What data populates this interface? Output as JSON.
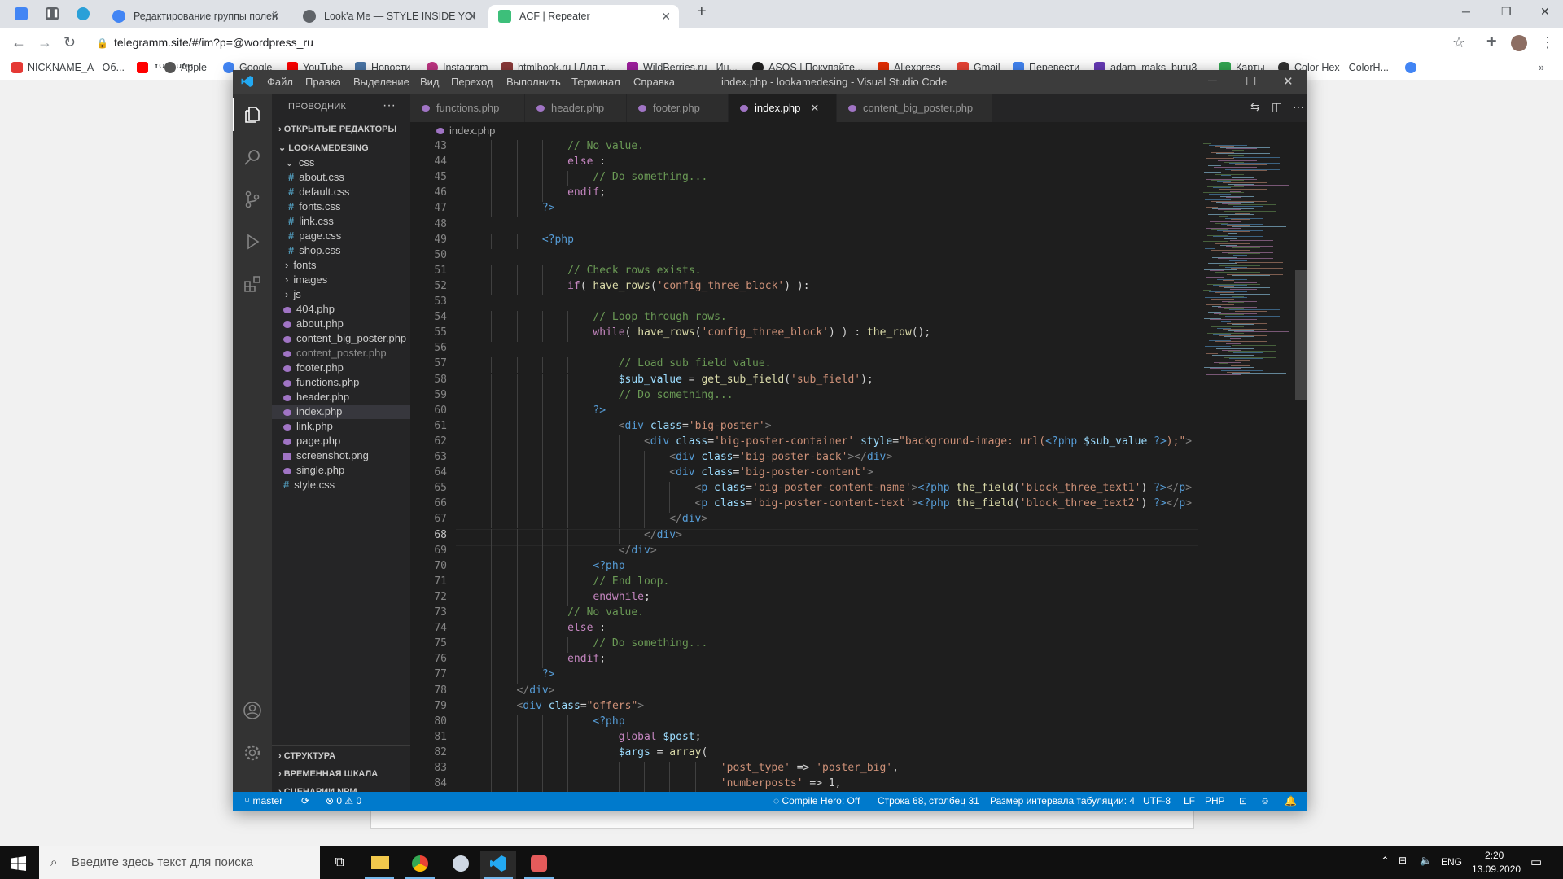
{
  "browser": {
    "tabs": [
      {
        "title": "Редактирование группы полей",
        "color": "#4285f4"
      },
      {
        "title": "Look'a Me — STYLE INSIDE YOU",
        "color": "#5f6368"
      },
      {
        "title": "ACF | Repeater",
        "color": "#3dbf7a"
      }
    ],
    "url": "telegramm.site/#/im?p=@wordpress_ru",
    "bookmarks": [
      "NICKNAME_A - Об...",
      "YouTube",
      "Apple",
      "Google",
      "Новости",
      "Instagram",
      "htmlbook.ru | Для т...",
      "WildBerries.ru - Ин...",
      "ASOS | Покупайте...",
      "Aliexpress",
      "Gmail",
      "Перевести",
      "adam_maks_butu3",
      "Карты",
      "Color Hex - ColorH..."
    ]
  },
  "vscode": {
    "menu": [
      "Файл",
      "Правка",
      "Выделение",
      "Вид",
      "Переход",
      "Выполнить",
      "Терминал",
      "Справка"
    ],
    "window_title": "index.php - lookamedesing - Visual Studio Code",
    "explorer": {
      "title": "ПРОВОДНИК",
      "open_editors": "ОТКРЫТЫЕ РЕДАКТОРЫ",
      "project": "LOOKAMEDESING",
      "tree": [
        {
          "label": "css",
          "type": "folder-open"
        },
        {
          "label": "about.css",
          "type": "css"
        },
        {
          "label": "default.css",
          "type": "css"
        },
        {
          "label": "fonts.css",
          "type": "css"
        },
        {
          "label": "link.css",
          "type": "css"
        },
        {
          "label": "page.css",
          "type": "css"
        },
        {
          "label": "shop.css",
          "type": "css"
        },
        {
          "label": "fonts",
          "type": "folder"
        },
        {
          "label": "images",
          "type": "folder"
        },
        {
          "label": "js",
          "type": "folder"
        },
        {
          "label": "404.php",
          "type": "php"
        },
        {
          "label": "about.php",
          "type": "php"
        },
        {
          "label": "content_big_poster.php",
          "type": "php"
        },
        {
          "label": "content_poster.php",
          "type": "php-dim"
        },
        {
          "label": "footer.php",
          "type": "php"
        },
        {
          "label": "functions.php",
          "type": "php"
        },
        {
          "label": "header.php",
          "type": "php"
        },
        {
          "label": "index.php",
          "type": "php-sel"
        },
        {
          "label": "link.php",
          "type": "php"
        },
        {
          "label": "page.php",
          "type": "php"
        },
        {
          "label": "screenshot.png",
          "type": "img"
        },
        {
          "label": "single.php",
          "type": "php"
        },
        {
          "label": "style.css",
          "type": "css-root"
        }
      ],
      "bottom_sections": [
        "СТРУКТУРА",
        "ВРЕМЕННАЯ ШКАЛА",
        "СЦЕНАРИИ NPM"
      ]
    },
    "tabs": [
      "functions.php",
      "header.php",
      "footer.php",
      "index.php",
      "content_big_poster.php"
    ],
    "active_tab": "index.php",
    "breadcrumb": "index.php",
    "cursor_line": 68,
    "code_lines": [
      {
        "n": 43,
        "i": 4,
        "t": [
          [
            "c-cm",
            "// No value."
          ]
        ]
      },
      {
        "n": 44,
        "i": 4,
        "t": [
          [
            "c-kw",
            "else"
          ],
          [
            "c-w",
            " :"
          ]
        ]
      },
      {
        "n": 45,
        "i": 5,
        "t": [
          [
            "c-cm",
            "// Do something..."
          ]
        ]
      },
      {
        "n": 46,
        "i": 4,
        "t": [
          [
            "c-kw",
            "endif"
          ],
          [
            "c-w",
            ";"
          ]
        ]
      },
      {
        "n": 47,
        "i": 3,
        "t": [
          [
            "c-tag",
            "?>"
          ]
        ]
      },
      {
        "n": 48,
        "i": 0,
        "t": []
      },
      {
        "n": 49,
        "i": 3,
        "t": [
          [
            "c-tag",
            "<?php"
          ]
        ]
      },
      {
        "n": 50,
        "i": 0,
        "t": []
      },
      {
        "n": 51,
        "i": 4,
        "t": [
          [
            "c-cm",
            "// Check rows exists."
          ]
        ]
      },
      {
        "n": 52,
        "i": 4,
        "t": [
          [
            "c-kw",
            "if"
          ],
          [
            "c-w",
            "( "
          ],
          [
            "c-fn",
            "have_rows"
          ],
          [
            "c-w",
            "("
          ],
          [
            "c-str",
            "'config_three_block'"
          ],
          [
            "c-w",
            ") ):"
          ]
        ]
      },
      {
        "n": 53,
        "i": 0,
        "t": []
      },
      {
        "n": 54,
        "i": 5,
        "t": [
          [
            "c-cm",
            "// Loop through rows."
          ]
        ]
      },
      {
        "n": 55,
        "i": 5,
        "t": [
          [
            "c-kw",
            "while"
          ],
          [
            "c-w",
            "( "
          ],
          [
            "c-fn",
            "have_rows"
          ],
          [
            "c-w",
            "("
          ],
          [
            "c-str",
            "'config_three_block'"
          ],
          [
            "c-w",
            ") ) : "
          ],
          [
            "c-fn",
            "the_row"
          ],
          [
            "c-w",
            "();"
          ]
        ]
      },
      {
        "n": 56,
        "i": 0,
        "t": []
      },
      {
        "n": 57,
        "i": 6,
        "t": [
          [
            "c-cm",
            "// Load sub field value."
          ]
        ]
      },
      {
        "n": 58,
        "i": 6,
        "t": [
          [
            "c-var",
            "$sub_value"
          ],
          [
            "c-w",
            " = "
          ],
          [
            "c-fn",
            "get_sub_field"
          ],
          [
            "c-w",
            "("
          ],
          [
            "c-str",
            "'sub_field'"
          ],
          [
            "c-w",
            ");"
          ]
        ]
      },
      {
        "n": 59,
        "i": 6,
        "t": [
          [
            "c-cm",
            "// Do something..."
          ]
        ]
      },
      {
        "n": 60,
        "i": 5,
        "t": [
          [
            "c-tag",
            "?>"
          ]
        ]
      },
      {
        "n": 61,
        "i": 6,
        "t": [
          [
            "c-pun",
            "<"
          ],
          [
            "c-tag",
            "div"
          ],
          [
            "c-w",
            " "
          ],
          [
            "c-at",
            "class"
          ],
          [
            "c-w",
            "="
          ],
          [
            "c-str",
            "'big-poster'"
          ],
          [
            "c-pun",
            ">"
          ]
        ]
      },
      {
        "n": 62,
        "i": 7,
        "t": [
          [
            "c-pun",
            "<"
          ],
          [
            "c-tag",
            "div"
          ],
          [
            "c-w",
            " "
          ],
          [
            "c-at",
            "class"
          ],
          [
            "c-w",
            "="
          ],
          [
            "c-str",
            "'big-poster-container'"
          ],
          [
            "c-w",
            " "
          ],
          [
            "c-at",
            "style"
          ],
          [
            "c-w",
            "="
          ],
          [
            "c-str",
            "\"background-image: url("
          ],
          [
            "c-tag",
            "<?php"
          ],
          [
            "c-w",
            " "
          ],
          [
            "c-var",
            "$sub_value"
          ],
          [
            "c-w",
            " "
          ],
          [
            "c-tag",
            "?>"
          ],
          [
            "c-str",
            ");\""
          ],
          [
            "c-pun",
            ">"
          ]
        ]
      },
      {
        "n": 63,
        "i": 8,
        "t": [
          [
            "c-pun",
            "<"
          ],
          [
            "c-tag",
            "div"
          ],
          [
            "c-w",
            " "
          ],
          [
            "c-at",
            "class"
          ],
          [
            "c-w",
            "="
          ],
          [
            "c-str",
            "'big-poster-back'"
          ],
          [
            "c-pun",
            "></"
          ],
          [
            "c-tag",
            "div"
          ],
          [
            "c-pun",
            ">"
          ]
        ]
      },
      {
        "n": 64,
        "i": 8,
        "t": [
          [
            "c-pun",
            "<"
          ],
          [
            "c-tag",
            "div"
          ],
          [
            "c-w",
            " "
          ],
          [
            "c-at",
            "class"
          ],
          [
            "c-w",
            "="
          ],
          [
            "c-str",
            "'big-poster-content'"
          ],
          [
            "c-pun",
            ">"
          ]
        ]
      },
      {
        "n": 65,
        "i": 9,
        "t": [
          [
            "c-pun",
            "<"
          ],
          [
            "c-tag",
            "p"
          ],
          [
            "c-w",
            " "
          ],
          [
            "c-at",
            "class"
          ],
          [
            "c-w",
            "="
          ],
          [
            "c-str",
            "'big-poster-content-name'"
          ],
          [
            "c-pun",
            ">"
          ],
          [
            "c-tag",
            "<?php"
          ],
          [
            "c-w",
            " "
          ],
          [
            "c-fn",
            "the_field"
          ],
          [
            "c-w",
            "("
          ],
          [
            "c-str",
            "'block_three_text1'"
          ],
          [
            "c-w",
            ") "
          ],
          [
            "c-tag",
            "?>"
          ],
          [
            "c-pun",
            "</"
          ],
          [
            "c-tag",
            "p"
          ],
          [
            "c-pun",
            ">"
          ]
        ]
      },
      {
        "n": 66,
        "i": 9,
        "t": [
          [
            "c-pun",
            "<"
          ],
          [
            "c-tag",
            "p"
          ],
          [
            "c-w",
            " "
          ],
          [
            "c-at",
            "class"
          ],
          [
            "c-w",
            "="
          ],
          [
            "c-str",
            "'big-poster-content-text'"
          ],
          [
            "c-pun",
            ">"
          ],
          [
            "c-tag",
            "<?php"
          ],
          [
            "c-w",
            " "
          ],
          [
            "c-fn",
            "the_field"
          ],
          [
            "c-w",
            "("
          ],
          [
            "c-str",
            "'block_three_text2'"
          ],
          [
            "c-w",
            ") "
          ],
          [
            "c-tag",
            "?>"
          ],
          [
            "c-pun",
            "</"
          ],
          [
            "c-tag",
            "p"
          ],
          [
            "c-pun",
            ">"
          ]
        ]
      },
      {
        "n": 67,
        "i": 8,
        "t": [
          [
            "c-pun",
            "</"
          ],
          [
            "c-tag",
            "div"
          ],
          [
            "c-pun",
            ">"
          ]
        ]
      },
      {
        "n": 68,
        "i": 7,
        "t": [
          [
            "c-pun",
            "</"
          ],
          [
            "c-tag",
            "div"
          ],
          [
            "c-pun",
            ">"
          ]
        ]
      },
      {
        "n": 69,
        "i": 6,
        "t": [
          [
            "c-pun",
            "</"
          ],
          [
            "c-tag",
            "div"
          ],
          [
            "c-pun",
            ">"
          ]
        ]
      },
      {
        "n": 70,
        "i": 5,
        "t": [
          [
            "c-tag",
            "<?php"
          ]
        ]
      },
      {
        "n": 71,
        "i": 5,
        "t": [
          [
            "c-cm",
            "// End loop."
          ]
        ]
      },
      {
        "n": 72,
        "i": 5,
        "t": [
          [
            "c-kw",
            "endwhile"
          ],
          [
            "c-w",
            ";"
          ]
        ]
      },
      {
        "n": 73,
        "i": 4,
        "t": [
          [
            "c-cm",
            "// No value."
          ]
        ]
      },
      {
        "n": 74,
        "i": 4,
        "t": [
          [
            "c-kw",
            "else"
          ],
          [
            "c-w",
            " :"
          ]
        ]
      },
      {
        "n": 75,
        "i": 5,
        "t": [
          [
            "c-cm",
            "// Do something..."
          ]
        ]
      },
      {
        "n": 76,
        "i": 4,
        "t": [
          [
            "c-kw",
            "endif"
          ],
          [
            "c-w",
            ";"
          ]
        ]
      },
      {
        "n": 77,
        "i": 3,
        "t": [
          [
            "c-tag",
            "?>"
          ]
        ]
      },
      {
        "n": 78,
        "i": 2,
        "t": [
          [
            "c-pun",
            "</"
          ],
          [
            "c-tag",
            "div"
          ],
          [
            "c-pun",
            ">"
          ]
        ]
      },
      {
        "n": 79,
        "i": 2,
        "t": [
          [
            "c-pun",
            "<"
          ],
          [
            "c-tag",
            "div"
          ],
          [
            "c-w",
            " "
          ],
          [
            "c-at",
            "class"
          ],
          [
            "c-w",
            "="
          ],
          [
            "c-str",
            "\"offers\""
          ],
          [
            "c-pun",
            ">"
          ]
        ]
      },
      {
        "n": 80,
        "i": 5,
        "t": [
          [
            "c-tag",
            "<?php"
          ]
        ]
      },
      {
        "n": 81,
        "i": 6,
        "t": [
          [
            "c-kw",
            "global"
          ],
          [
            "c-w",
            " "
          ],
          [
            "c-var",
            "$post"
          ],
          [
            "c-w",
            ";"
          ]
        ]
      },
      {
        "n": 82,
        "i": 6,
        "t": [
          [
            "c-var",
            "$args"
          ],
          [
            "c-w",
            " = "
          ],
          [
            "c-fn",
            "array"
          ],
          [
            "c-w",
            "("
          ]
        ]
      },
      {
        "n": 83,
        "i": 10,
        "t": [
          [
            "c-str",
            "'post_type'"
          ],
          [
            "c-w",
            " => "
          ],
          [
            "c-str",
            "'poster_big'"
          ],
          [
            "c-w",
            ","
          ]
        ]
      },
      {
        "n": 84,
        "i": 10,
        "t": [
          [
            "c-str",
            "'numberposts'"
          ],
          [
            "c-w",
            " => "
          ],
          [
            "c-w",
            "1,"
          ]
        ]
      }
    ],
    "status": {
      "branch": "master",
      "errors": "0",
      "warnings": "0",
      "compile_hero": "Compile Hero: Off",
      "position": "Строка 68, столбец 31",
      "indent": "Размер интервала табуляции: 4",
      "encoding": "UTF-8",
      "eol": "LF",
      "language": "PHP"
    }
  },
  "taskbar": {
    "search_placeholder": "Введите здесь текст для поиска",
    "lang": "ENG",
    "time": "2:20",
    "date": "13.09.2020"
  }
}
